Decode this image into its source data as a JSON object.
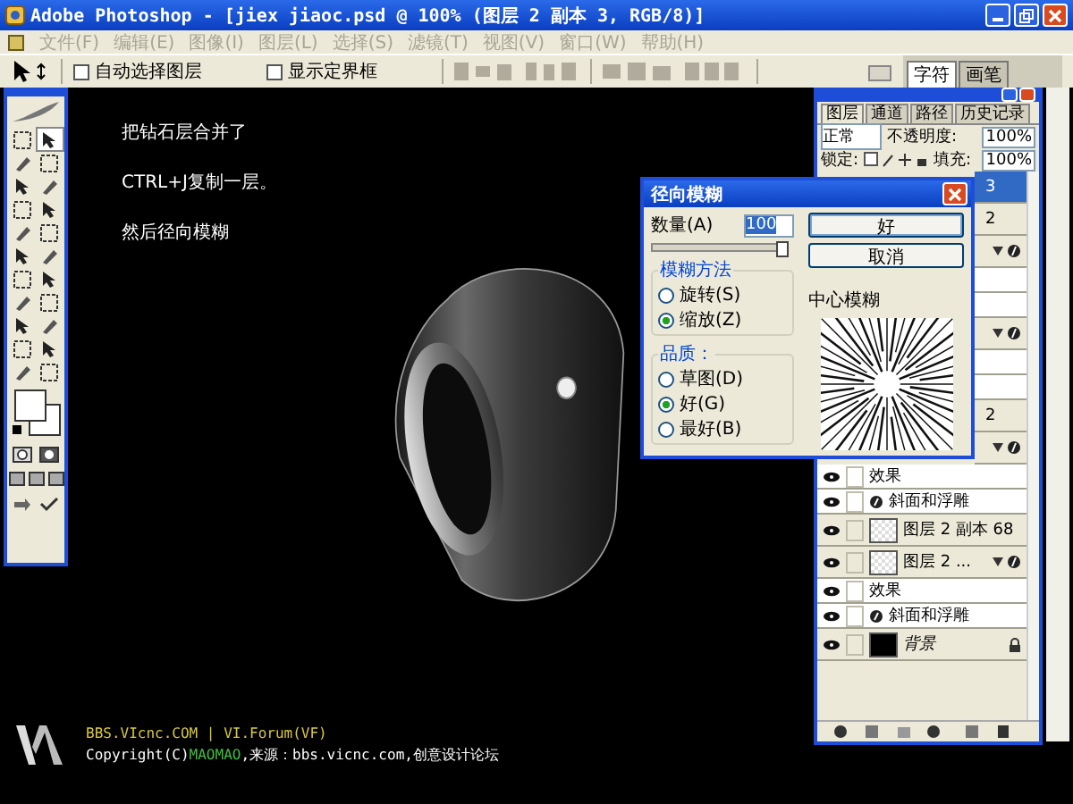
{
  "window": {
    "title": "Adobe Photoshop - [jiex  jiaoc.psd @ 100% (图层 2 副本 3, RGB/8)]"
  },
  "menu": [
    {
      "label": "文件(F)",
      "disabled": true
    },
    {
      "label": "编辑(E)",
      "disabled": true
    },
    {
      "label": "图像(I)",
      "disabled": true
    },
    {
      "label": "图层(L)",
      "disabled": true
    },
    {
      "label": "选择(S)",
      "disabled": true
    },
    {
      "label": "滤镜(T)",
      "disabled": true
    },
    {
      "label": "视图(V)",
      "disabled": true
    },
    {
      "label": "窗口(W)",
      "disabled": true
    },
    {
      "label": "帮助(H)",
      "disabled": true
    }
  ],
  "options_bar": {
    "checkboxes": [
      {
        "label": "自动选择图层",
        "checked": false
      },
      {
        "label": "显示定界框",
        "checked": false
      }
    ],
    "palette_tabs": [
      {
        "label": "字符",
        "selected": true
      },
      {
        "label": "画笔",
        "selected": false
      }
    ]
  },
  "notes": [
    "把钻石层合并了",
    "CTRL+J复制一层。",
    "然后径向模糊"
  ],
  "dialog": {
    "title": "径向模糊",
    "amount_label": "数量(A)",
    "amount": "100",
    "level": 1.0,
    "ok": "好",
    "cancel": "取消",
    "method_title": "模糊方法",
    "methods": [
      {
        "label": "旋转(S)",
        "selected": false
      },
      {
        "label": "缩放(Z)",
        "selected": true
      }
    ],
    "quality_title": "品质：",
    "qualities": [
      {
        "label": "草图(D)",
        "selected": false
      },
      {
        "label": "好(G)",
        "selected": true
      },
      {
        "label": "最好(B)",
        "selected": false
      }
    ],
    "center_label": "中心模糊"
  },
  "layers_panel": {
    "tabs": [
      {
        "label": "图层",
        "selected": true
      },
      {
        "label": "通道",
        "selected": false
      },
      {
        "label": "路径",
        "selected": false
      },
      {
        "label": "历史记录",
        "selected": false
      }
    ],
    "blend_mode": "正常",
    "opacity_label": "不透明度:",
    "opacity": "100%",
    "lock_label": "锁定:",
    "fill_label": "填充:",
    "fill": "100%",
    "rows": [
      {
        "kind": "stub",
        "name": "3",
        "selected": true,
        "fx": false
      },
      {
        "kind": "stub",
        "name": "2",
        "selected": false,
        "fx": false
      },
      {
        "kind": "hidden",
        "selected": false,
        "fx": true
      },
      {
        "kind": "hidden-sub",
        "selected": false,
        "fx": false
      },
      {
        "kind": "hidden-sub",
        "selected": false,
        "fx": false
      },
      {
        "kind": "hidden",
        "selected": false,
        "fx": true
      },
      {
        "kind": "hidden-sub",
        "selected": false,
        "fx": false
      },
      {
        "kind": "hidden-sub",
        "selected": false,
        "fx": false
      },
      {
        "kind": "stub",
        "name": "2",
        "selected": false,
        "fx": false
      },
      {
        "kind": "hidden",
        "selected": false,
        "fx": true
      },
      {
        "kind": "effects",
        "name": "效果",
        "selected": false,
        "fx": false
      },
      {
        "kind": "effect",
        "name": "斜面和浮雕",
        "selected": false,
        "fx": false
      },
      {
        "kind": "layer",
        "name": "图层 2 副本 68",
        "selected": false,
        "fx": false
      },
      {
        "kind": "layer",
        "name": "图层 2 ...",
        "selected": false,
        "fx": true
      },
      {
        "kind": "effects",
        "name": "效果",
        "selected": false,
        "fx": false
      },
      {
        "kind": "effect",
        "name": "斜面和浮雕",
        "selected": false,
        "fx": false
      },
      {
        "kind": "background",
        "name": "背景",
        "selected": false,
        "fx": false
      }
    ]
  },
  "credits": {
    "site": "BBS.VIcnc.COM",
    "separator": "|",
    "forum": "VI.Forum(VF)",
    "copyright": "Copyright(C)",
    "author": "MAOMAO",
    "source": ",来源：bbs.vicnc.com,创意设计论坛"
  }
}
